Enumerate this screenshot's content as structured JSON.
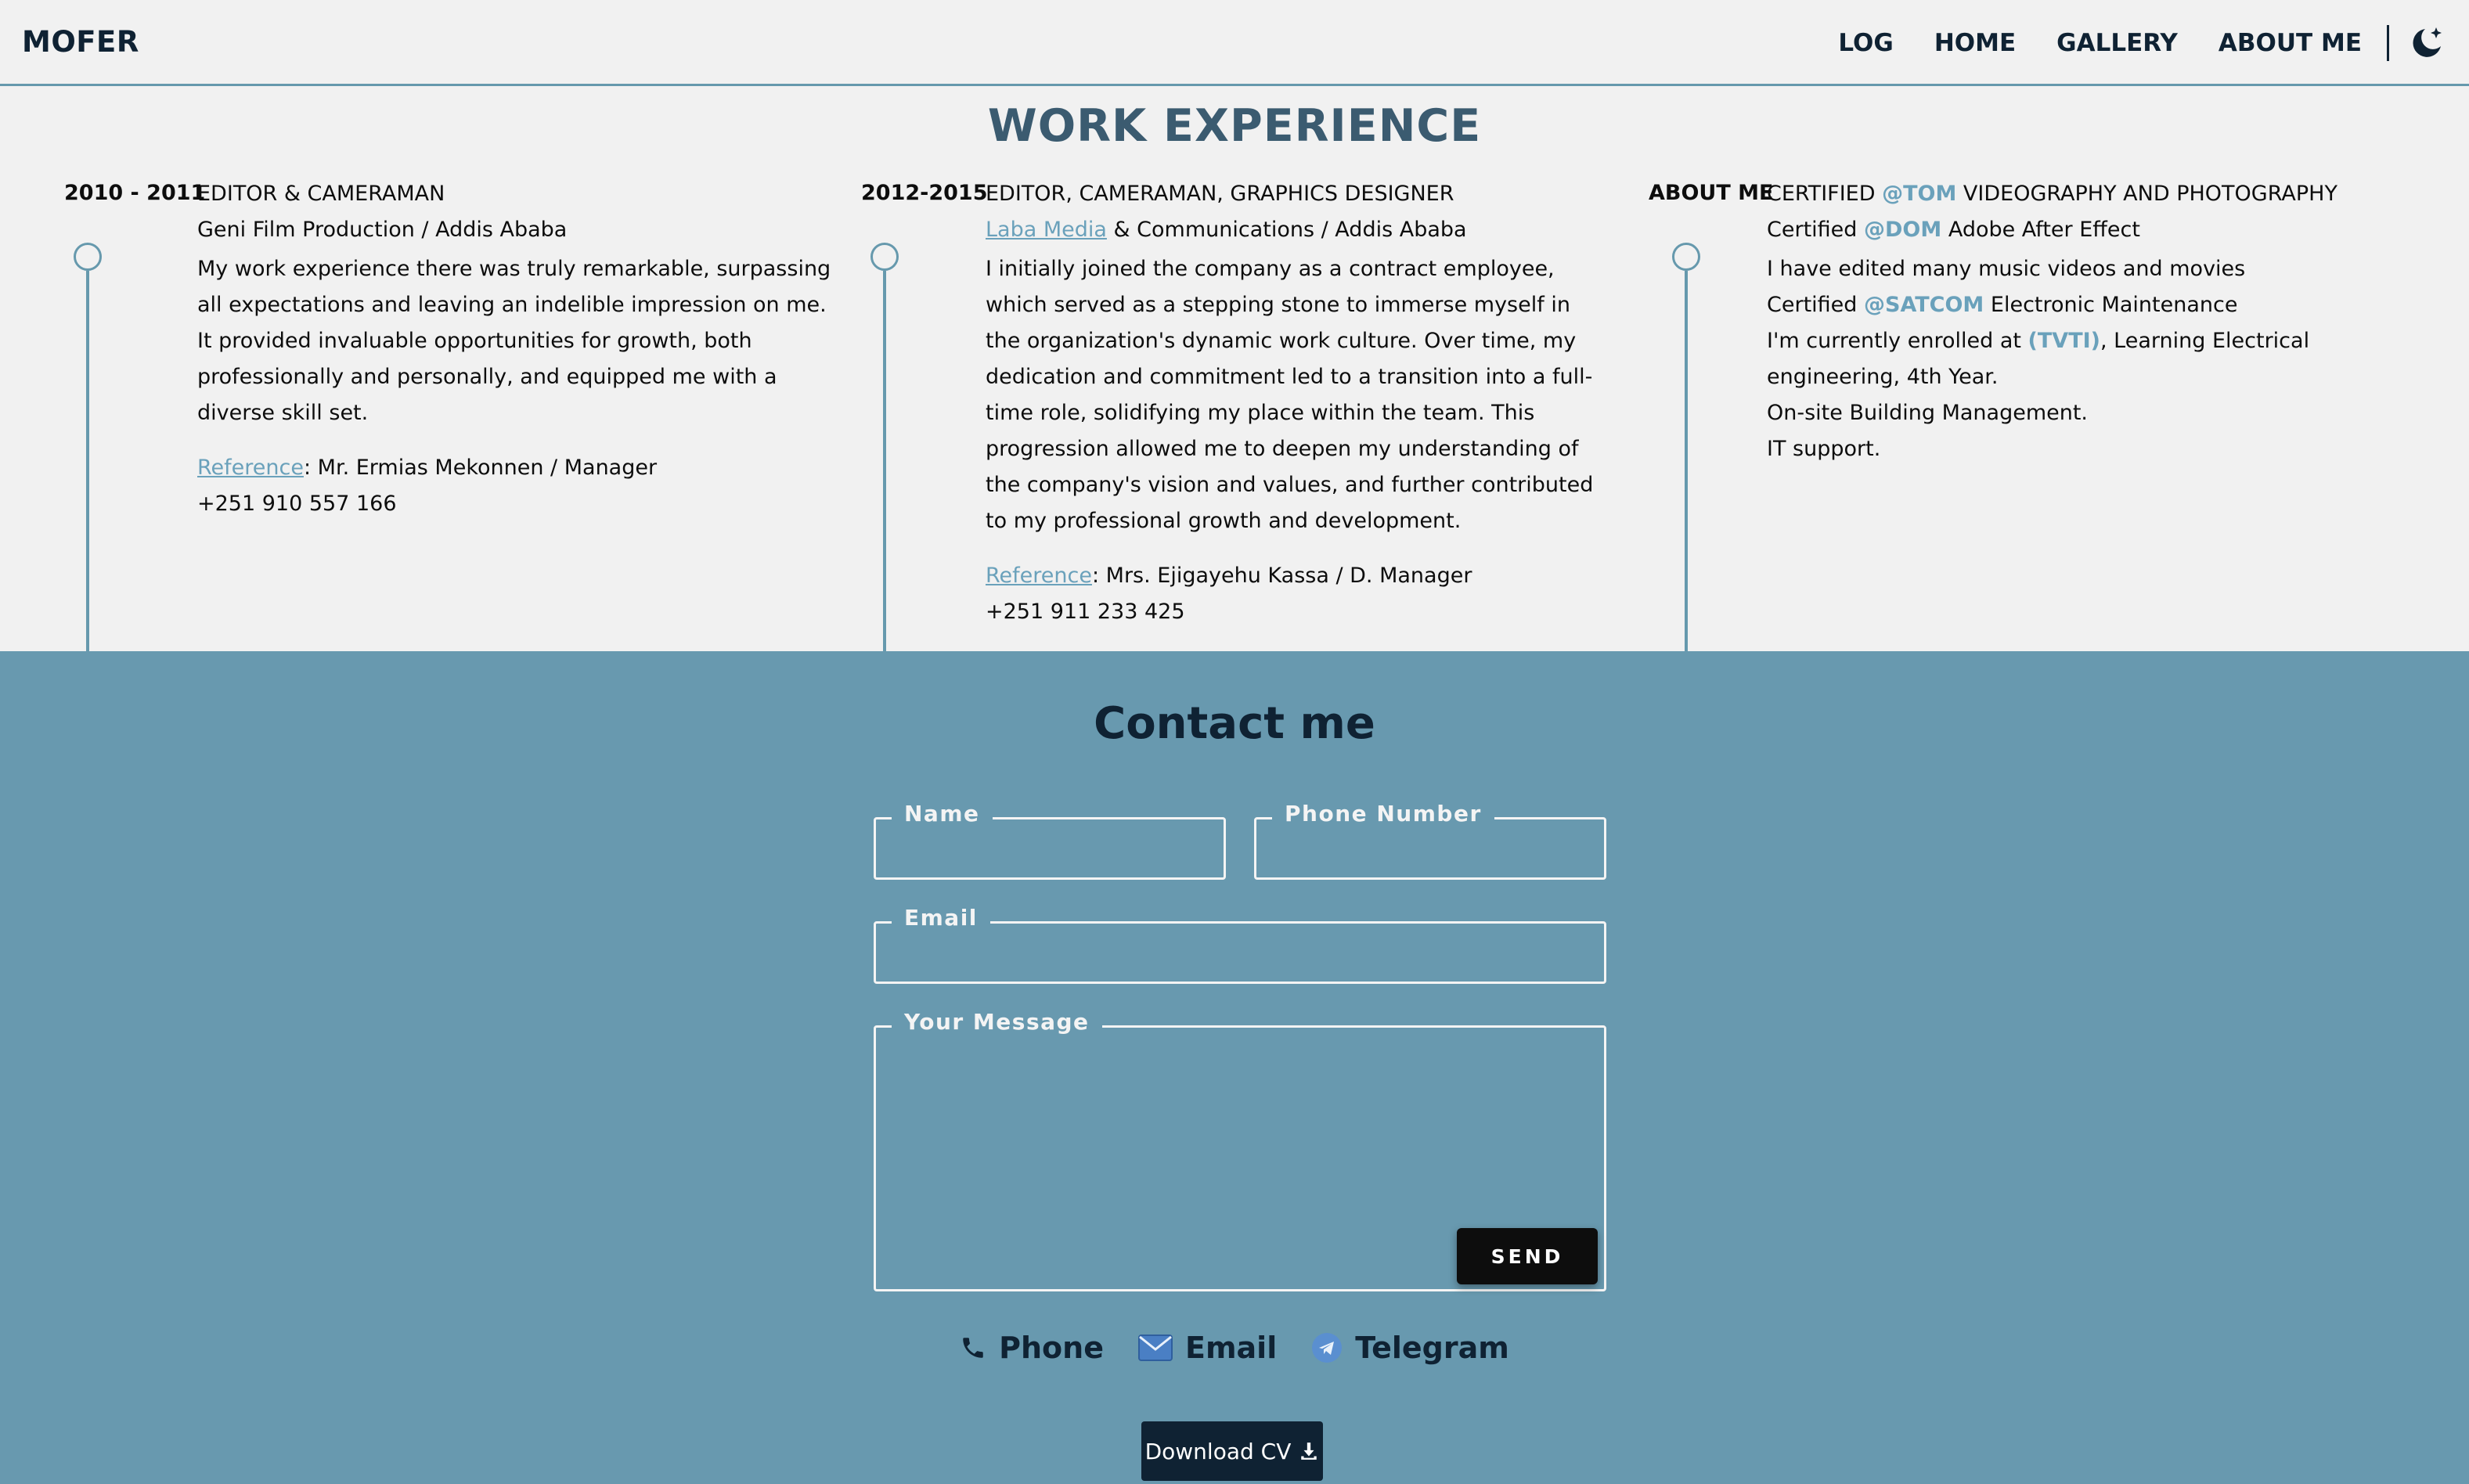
{
  "header": {
    "logo": "MOFER",
    "nav": [
      "LOG",
      "HOME",
      "GALLERY",
      "ABOUT ME"
    ],
    "theme_icon": "moon-stars-icon"
  },
  "work": {
    "title": "WORK EXPERIENCE",
    "col1": {
      "years": "2010 - 2011",
      "role": "EDITOR & CAMERAMAN",
      "company": "Geni Film Production / Addis Ababa",
      "description": "My work experience there was truly remarkable, surpassing all expectations and leaving an indelible impression on me. It provided invaluable opportunities for growth, both professionally and personally, and equipped me with a diverse skill set.",
      "reference_label": "Reference",
      "reference_value": ": Mr. Ermias Mekonnen / Manager",
      "phone": "+251 910 557 166"
    },
    "col2": {
      "years": "2012-2015",
      "role": "EDITOR, CAMERAMAN, GRAPHICS DESIGNER",
      "company_link": "Laba Media",
      "company_rest": " & Communications / Addis Ababa",
      "description": "I initially joined the company as a contract employee, which served as a stepping stone to immerse myself in the organization's dynamic work culture. Over time, my dedication and commitment led to a transition into a full-time role, solidifying my place within the team. This progression allowed me to deepen my understanding of the company's vision and values, and further contributed to my professional growth and development.",
      "reference_label": "Reference",
      "reference_value": ": Mrs. Ejigayehu Kassa / D. Manager",
      "phone": "+251 911 233 425"
    },
    "col3": {
      "label": "ABOUT ME",
      "l1_pre": "CERTIFIED ",
      "l1_accent": "@TOM",
      "l1_post": " VIDEOGRAPHY AND PHOTOGRAPHY",
      "l2_pre": "Certified ",
      "l2_accent": "@DOM",
      "l2_post": " Adobe After Effect",
      "l3": "I have edited many music videos and movies",
      "l4_pre": "Certified ",
      "l4_accent": "@SATCOM",
      "l4_post": " Electronic Maintenance",
      "l5_pre": "I'm currently enrolled at ",
      "l5_accent": "(TVTI)",
      "l5_post": ", Learning Electrical engineering, 4th Year.",
      "l6": "On-site Building Management.",
      "l7": "IT support."
    }
  },
  "contact": {
    "title": "Contact me",
    "name_label": "Name",
    "phone_label": "Phone Number",
    "email_label": "Email",
    "message_label": "Your Message",
    "send": "SEND",
    "socials": [
      {
        "label": "Phone",
        "icon": "phone-icon"
      },
      {
        "label": "Email",
        "icon": "envelope-icon"
      },
      {
        "label": "Telegram",
        "icon": "telegram-icon"
      }
    ],
    "download_cv": "Download CV",
    "download_icon": "download-icon"
  },
  "colors": {
    "accent": "#6699ad",
    "contact_bg": "#6899af",
    "dark": "#0f2233",
    "link": "#6aa1bb"
  }
}
